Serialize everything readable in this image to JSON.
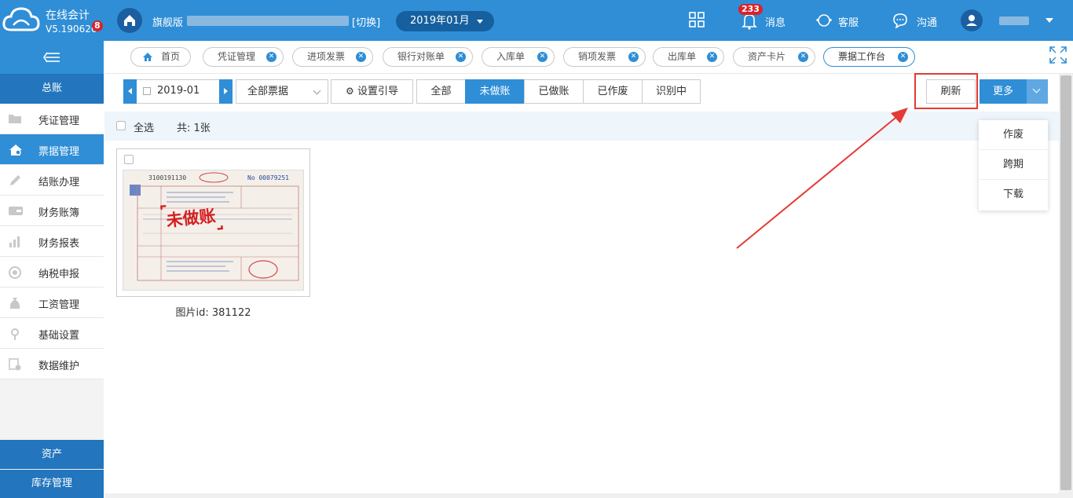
{
  "app": {
    "name": "在线会计",
    "version": "V5.190626",
    "version_badge": "8"
  },
  "header": {
    "edition": "旗舰版",
    "switch_label": "[切换]",
    "period": "2019年01月",
    "messages_badge": "233",
    "messages_label": "消息",
    "service_label": "客服",
    "chat_label": "沟通"
  },
  "sidebar": {
    "group_top": "总账",
    "items": [
      {
        "label": "凭证管理",
        "icon": "folder-icon"
      },
      {
        "label": "票据管理",
        "icon": "home-gear-icon"
      },
      {
        "label": "结账办理",
        "icon": "pen-icon"
      },
      {
        "label": "财务账簿",
        "icon": "wallet-icon"
      },
      {
        "label": "财务报表",
        "icon": "bar-chart-icon"
      },
      {
        "label": "纳税申报",
        "icon": "tax-icon"
      },
      {
        "label": "工资管理",
        "icon": "money-bag-icon"
      },
      {
        "label": "基础设置",
        "icon": "settings-icon"
      },
      {
        "label": "数据维护",
        "icon": "database-icon"
      }
    ],
    "group_assets": "资产",
    "group_inventory": "库存管理"
  },
  "tabs": [
    {
      "label": "首页"
    },
    {
      "label": "凭证管理"
    },
    {
      "label": "进项发票"
    },
    {
      "label": "银行对账单"
    },
    {
      "label": "入库单"
    },
    {
      "label": "销项发票"
    },
    {
      "label": "出库单"
    },
    {
      "label": "资产卡片"
    },
    {
      "label": "票据工作台"
    }
  ],
  "toolbar": {
    "date_value": "2019-01",
    "bill_filter": "全部票据",
    "guide_label": "设置引导",
    "segments": [
      "全部",
      "未做账",
      "已做账",
      "已作废",
      "识别中"
    ],
    "active_segment": "未做账",
    "refresh_label": "刷新",
    "more_label": "更多"
  },
  "more_menu": [
    "作废",
    "跨期",
    "下载"
  ],
  "selection": {
    "select_all": "全选",
    "total": "共: 1张"
  },
  "invoice_card": {
    "caption": "图片id: 381122",
    "stamp_text": "未做账",
    "invoice_code": "3100191130",
    "invoice_no": "No 00079251"
  },
  "colors": {
    "primary": "#2f8ed6",
    "sidebar_group": "#2375bd",
    "alert": "#e53935",
    "badge": "#d9222a"
  }
}
